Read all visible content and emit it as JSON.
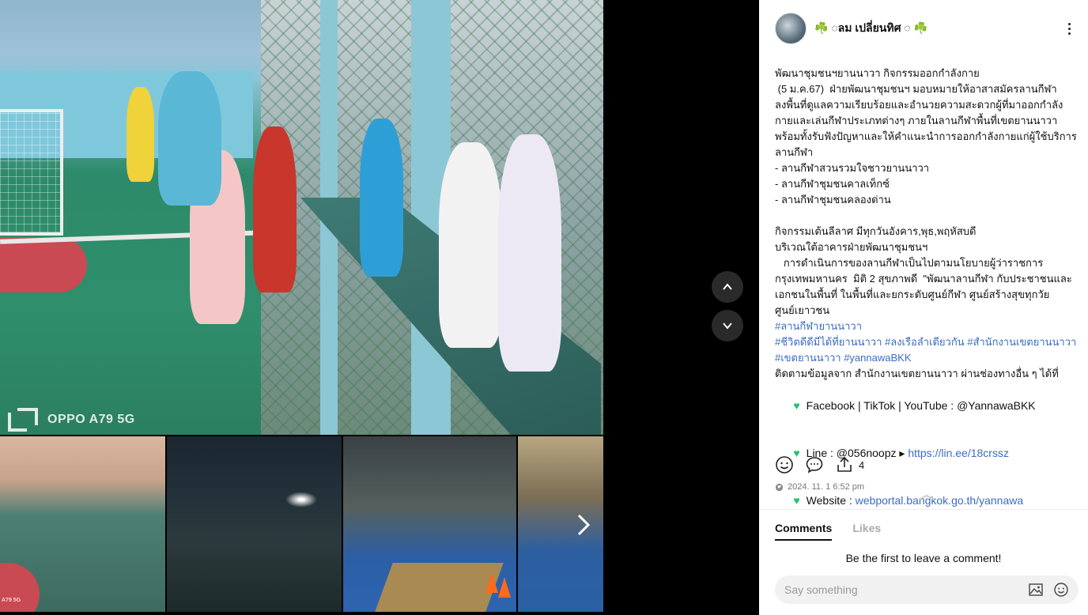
{
  "viewer": {
    "watermark": "OPPO A79 5G",
    "thumb_watermark": "A79 5G",
    "next_icon": "chevron-right-icon",
    "nav_up_icon": "chevron-up-icon",
    "nav_down_icon": "chevron-down-icon"
  },
  "post": {
    "author": "☘️ ◌ลม เปลี่ยนทิศ ◌ ☘️",
    "body_lines": [
      "พัฒนาชุมชนฯยานนาวา กิจกรรมออกกำลังกาย",
      " (5 ม.ค.67)  ฝ่ายพัฒนาชุมชนฯ มอบหมายให้อาสาสมัครลานกีฬา ลงพื้นที่ดูแลความเรียบร้อยและอำนวยความสะดวกผู้ที่มาออกกำลังกายและเล่นกีฬาประเภทต่างๆ ภายในลานกีฬาพื้นที่เขตยานนาวา พร้อมทั้งรับฟังปัญหาและให้คำแนะนำการออกกำลังกายแก่ผู้ใช้บริการลานกีฬา",
      "- ลานกีฬาสวนรวมใจชาวยานนาวา",
      "- ลานกีฬาชุมชนคาลเท็กซ์",
      "- ลานกีฬาชุมชนคลองด่าน",
      "",
      "กิจกรรมเต้นลีลาศ มีทุกวันอังคาร,พุธ,พฤหัสบดี",
      "บริเวณใต้อาคารฝ่ายพัฒนาชุมชนฯ",
      "   การดำเนินการของลานกีฬาเป็นไปตามนโยบายผู้ว่าราชการกรุงเทพมหานคร  มิติ 2 สุขภาพดี  \"พัฒนาลานกีฬา กับประชาชนและเอกชนในพื้นที่ ในพื้นที่และยกระดับศูนย์กีฬา ศูนย์สร้างสุขทุกวัย ศูนย์เยาวชน"
    ],
    "hashtags_1": "#ลานกีฬายานนาวา",
    "hashtags_2": "#ชีวิตดีดีมีได้ที่ยานนาวา #ลงเรือลำเดียวกัน #สำนักงานเขตยานนาวา #เขตยานนาวา #yannawaBKK",
    "follow_text": "ติดตามข้อมูลจาก สำนักงานเขตยานนาวา ผ่านช่องทางอื่น ๆ ได้ที่",
    "contact_1": "Facebook | TikTok | YouTube : @YannawaBKK",
    "contact_2_prefix": "Line : @056noopz ▸ ",
    "contact_2_link": "https://lin.ee/18crssz",
    "contact_3_prefix": "Website : ",
    "contact_3_link": "webportal.bangkok.go.th/yannawa",
    "share_count": "4",
    "timestamp": "2024. 11. 1 6:52 pm"
  },
  "tabs": {
    "comments": "Comments",
    "likes": "Likes"
  },
  "empty_comments": "Be the first to leave a comment!",
  "comment_input": {
    "placeholder": "Say something"
  },
  "colors": {
    "accent_link": "#3b6cc4",
    "heart_green": "#1bc56b"
  }
}
